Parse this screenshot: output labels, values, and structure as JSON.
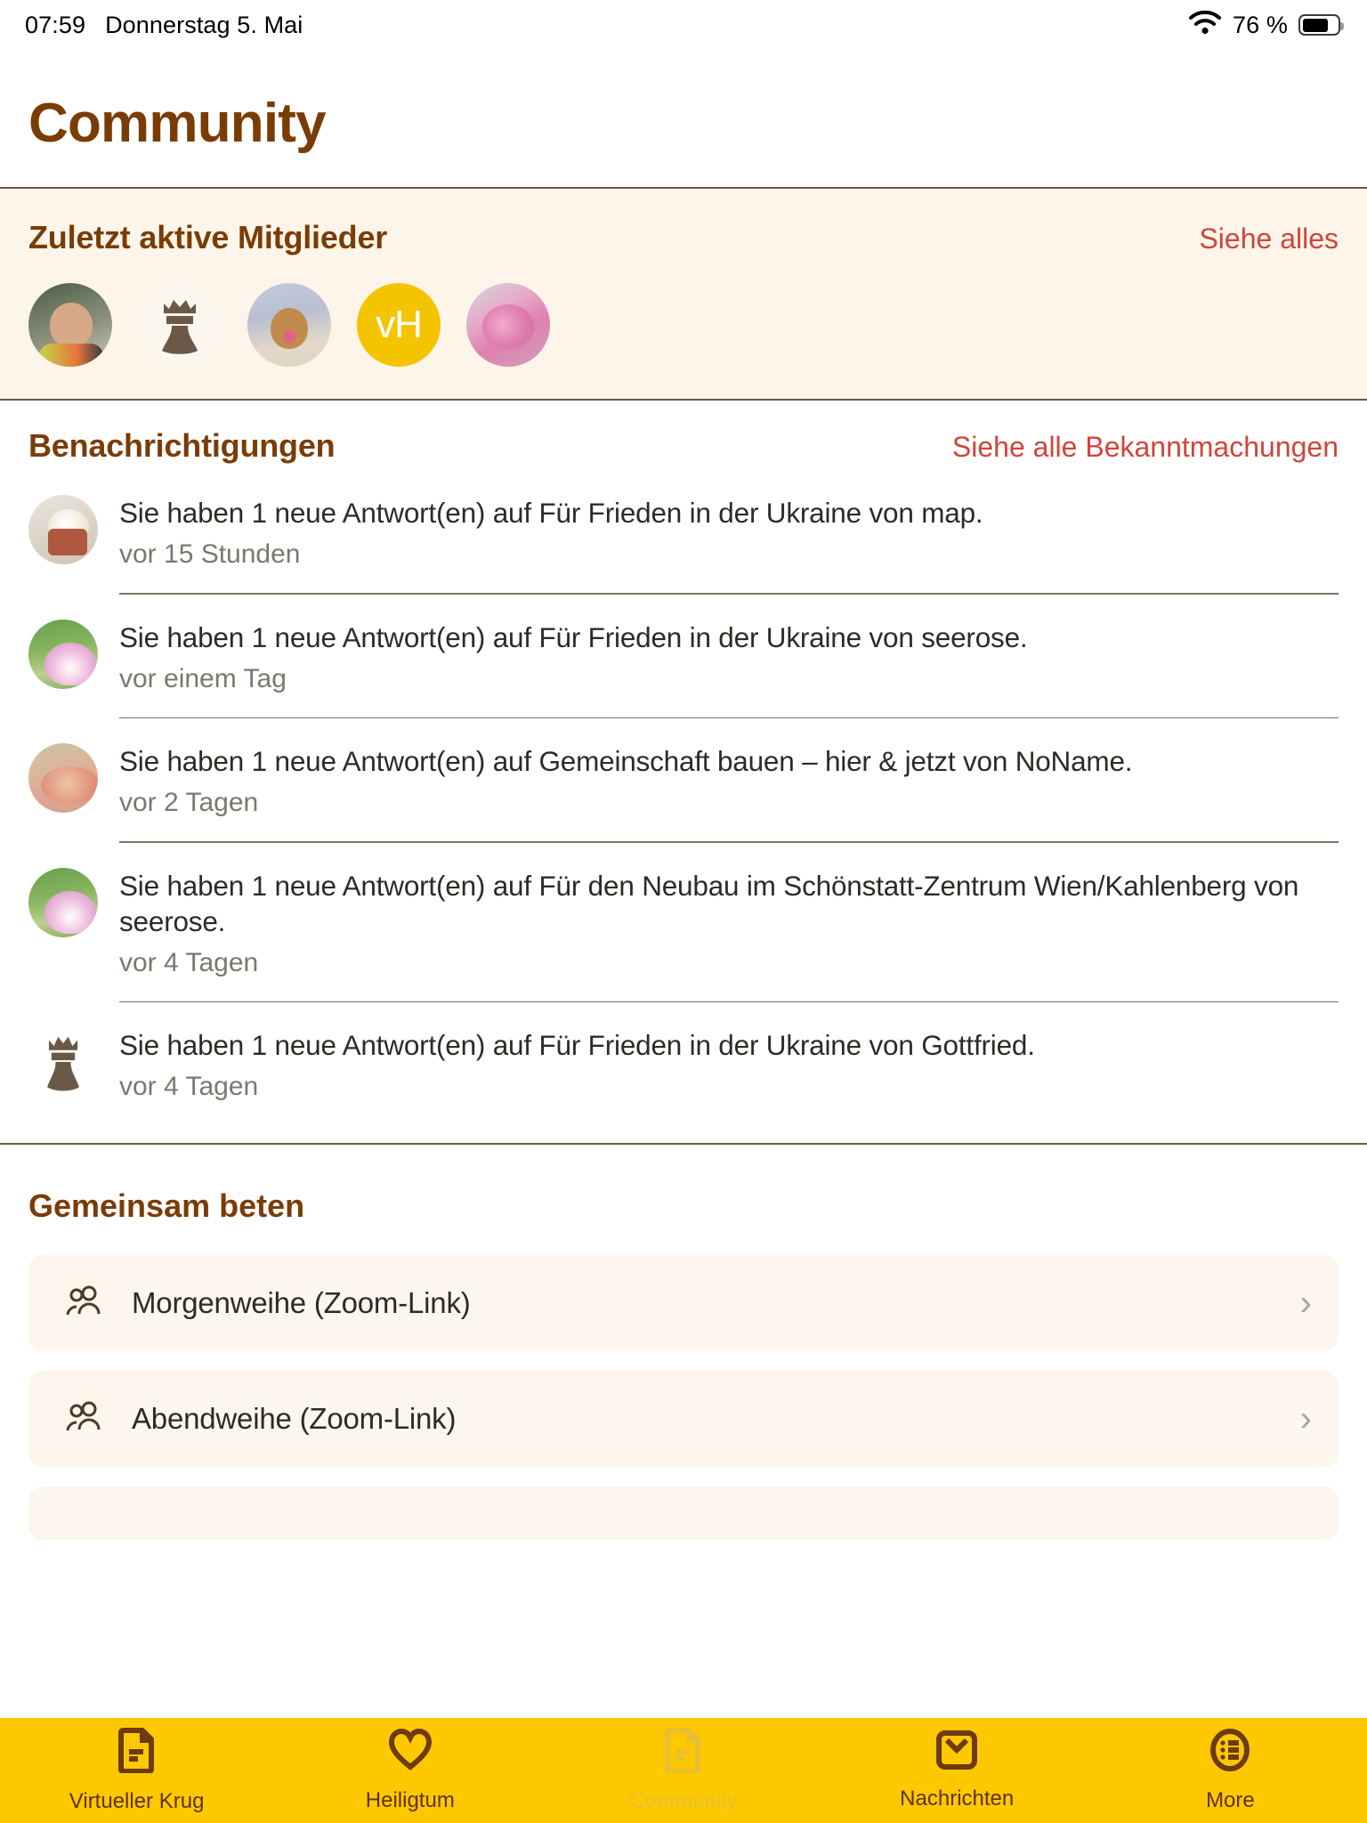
{
  "statusbar": {
    "time": "07:59",
    "date": "Donnerstag 5. Mai",
    "battery_percent": "76 %",
    "wifi_icon": "wifi-icon",
    "battery_icon": "battery-icon"
  },
  "header": {
    "title": "Community"
  },
  "members_section": {
    "title": "Zuletzt aktive Mitglieder",
    "see_all": "Siehe alles",
    "avatars": [
      {
        "name": "avatar-man-photo",
        "kind": "photo-man",
        "initials": ""
      },
      {
        "name": "avatar-crown",
        "kind": "crown",
        "initials": ""
      },
      {
        "name": "avatar-dog-photo",
        "kind": "photo-dog",
        "initials": ""
      },
      {
        "name": "avatar-vh-monogram",
        "kind": "monogram",
        "initials": "vH"
      },
      {
        "name": "avatar-blossom-photo",
        "kind": "photo-blossom",
        "initials": ""
      }
    ]
  },
  "notifications_section": {
    "title": "Benachrichtigungen",
    "see_all": "Siehe alle Bekanntmachungen",
    "items": [
      {
        "avatar_kind": "photo-plant",
        "text": "Sie haben 1 neue Antwort(en) auf Für Frieden in der Ukraine von map.",
        "time": "vor 15 Stunden"
      },
      {
        "avatar_kind": "photo-lotus",
        "text": "Sie haben 1 neue Antwort(en) auf Für Frieden in der Ukraine von seerose.",
        "time": "vor einem Tag"
      },
      {
        "avatar_kind": "photo-fish",
        "text": "Sie haben 1 neue Antwort(en) auf Gemeinschaft bauen – hier & jetzt von NoName.",
        "time": "vor 2 Tagen"
      },
      {
        "avatar_kind": "photo-lotus",
        "text": "Sie haben 1 neue Antwort(en) auf Für den Neubau im Schönstatt-Zentrum Wien/Kahlenberg von seerose.",
        "time": "vor 4 Tagen"
      },
      {
        "avatar_kind": "crown",
        "text": "Sie haben 1 neue Antwort(en) auf Für Frieden in der Ukraine von Gottfried.",
        "time": "vor 4 Tagen"
      }
    ]
  },
  "pray_section": {
    "title": "Gemeinsam beten",
    "items": [
      {
        "label": "Morgenweihe (Zoom-Link)",
        "icon": "people-icon",
        "chevron": "›"
      },
      {
        "label": "Abendweihe (Zoom-Link)",
        "icon": "people-icon",
        "chevron": "›"
      }
    ]
  },
  "tabbar": {
    "tabs": [
      {
        "label": "Virtueller Krug",
        "icon": "document-icon",
        "active": false
      },
      {
        "label": "Heiligtum",
        "icon": "heart-icon",
        "active": false
      },
      {
        "label": "Community",
        "icon": "document-icon",
        "active": true
      },
      {
        "label": "Nachrichten",
        "icon": "envelope-icon",
        "active": false
      },
      {
        "label": "More",
        "icon": "list-circle-icon",
        "active": false
      }
    ]
  },
  "colors": {
    "brand_brown": "#7a3c05",
    "link_red": "#d0453b",
    "cream": "#fdf5e9",
    "tab_yellow": "#fdc800",
    "tab_inactive": "#e9bf2e",
    "divider": "#6b5b44"
  }
}
